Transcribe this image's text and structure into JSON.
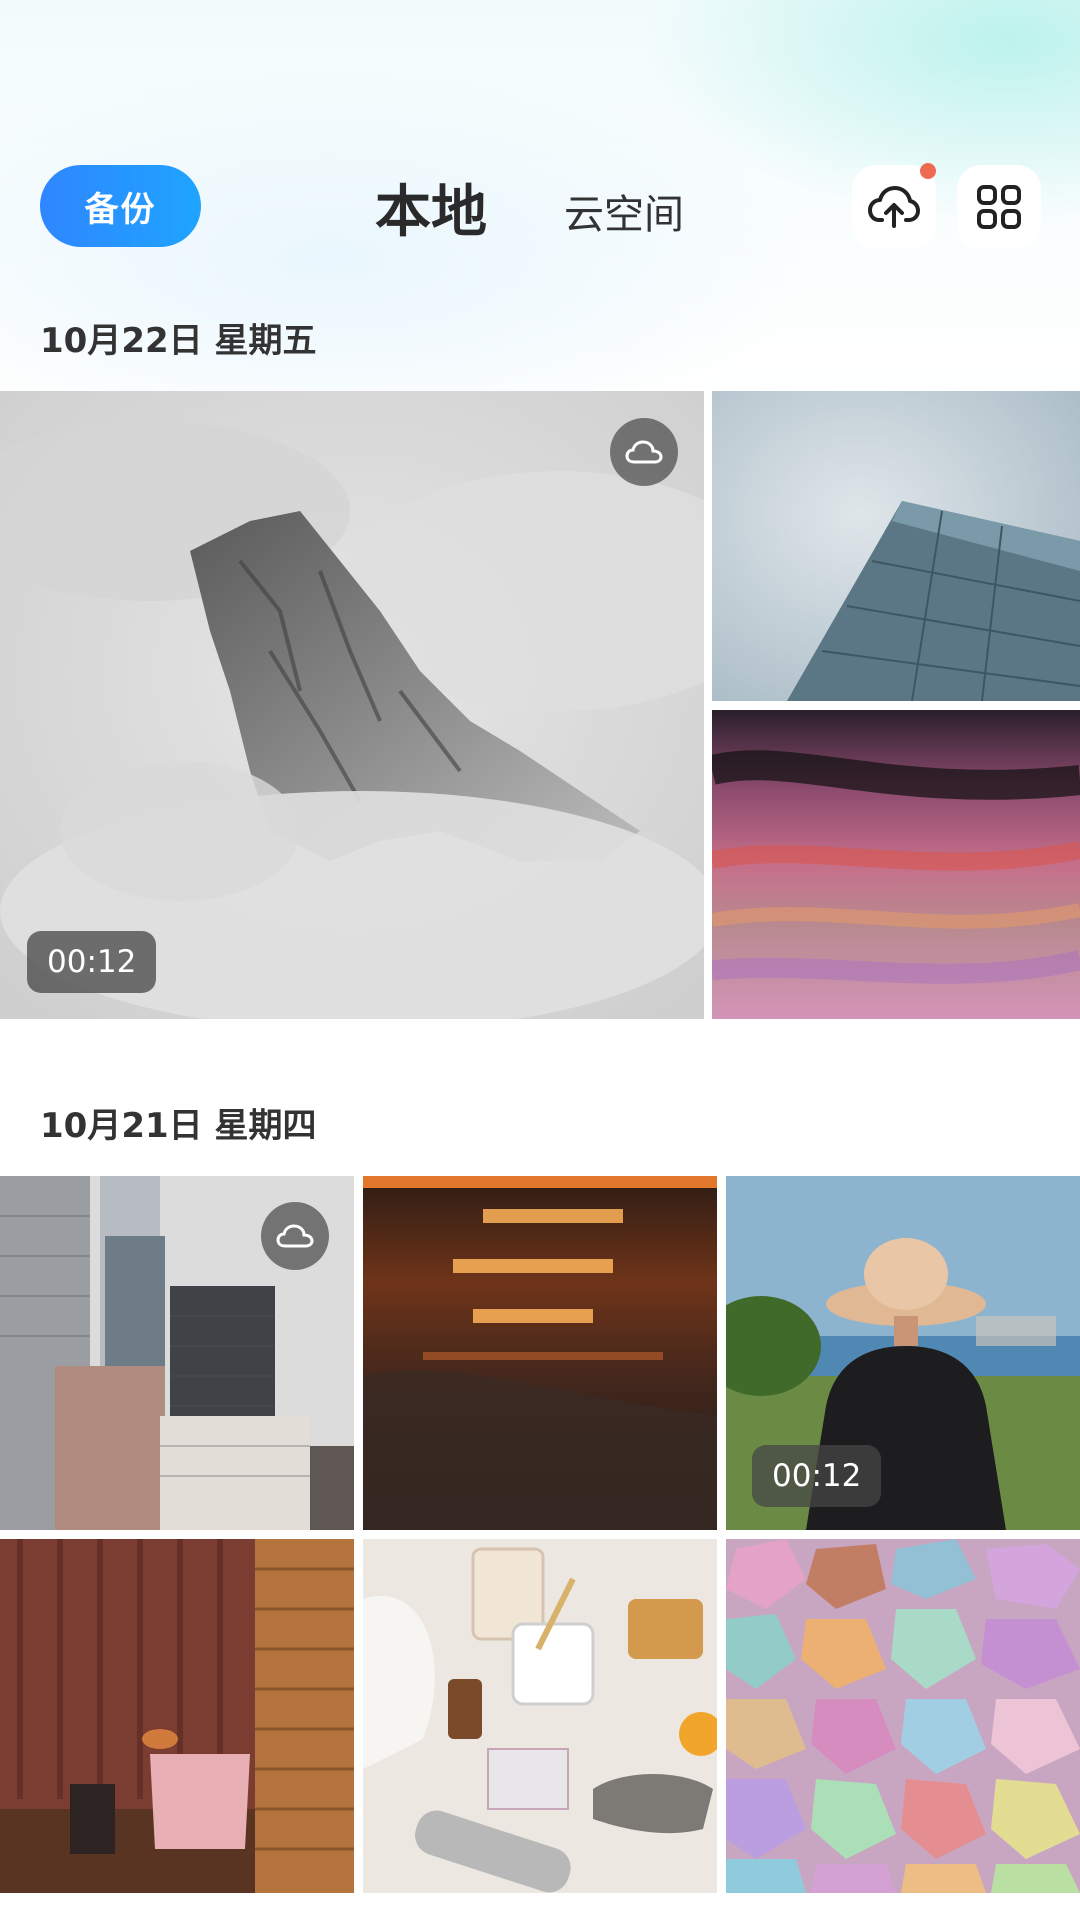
{
  "header": {
    "backup_label": "备份",
    "tab_local": "本地",
    "tab_cloud": "云空间",
    "upload_icon": "cloud-upload-icon",
    "grid_icon": "grid-view-icon",
    "notification_color": "#ee6a50"
  },
  "sections": [
    {
      "date": "10月22日  星期五",
      "video_duration": "00:12"
    },
    {
      "date": "10月21日  星期四",
      "video_duration": "00:12"
    }
  ]
}
